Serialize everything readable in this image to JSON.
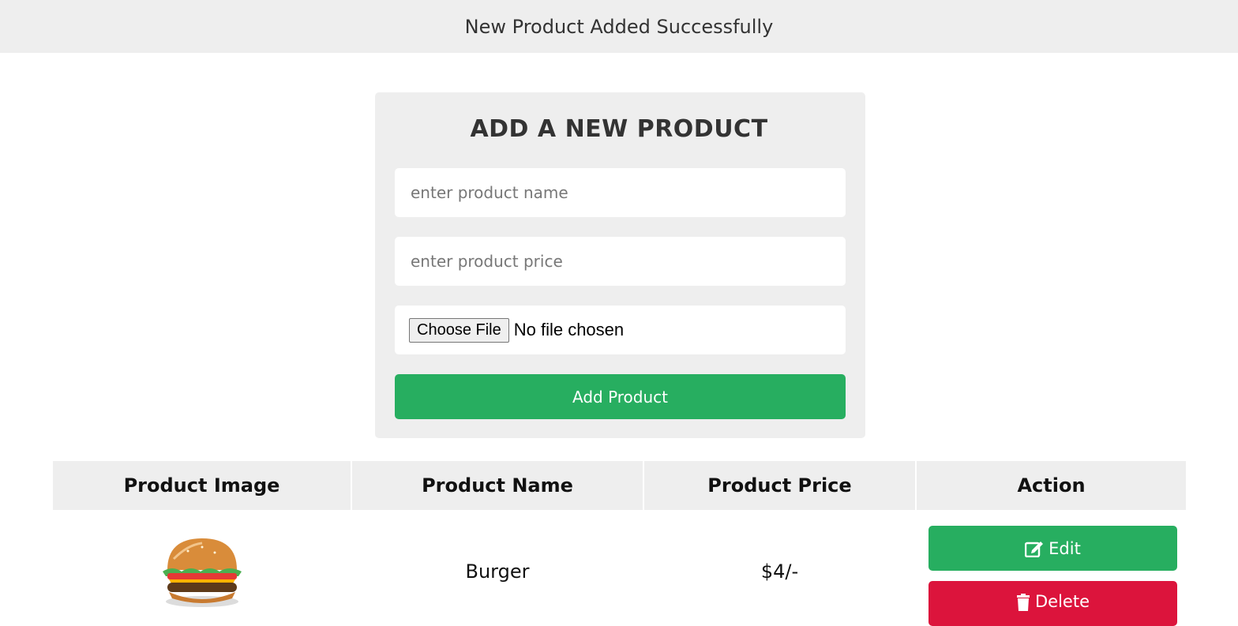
{
  "message": "New Product Added Successfully",
  "form": {
    "title": "ADD A NEW PRODUCT",
    "name_placeholder": "enter product name",
    "price_placeholder": "enter product price",
    "file_button": "Choose File",
    "file_status": "No file chosen",
    "submit_label": "Add Product"
  },
  "table": {
    "headers": [
      "Product Image",
      "Product Name",
      "Product Price",
      "Action"
    ],
    "rows": [
      {
        "image": "burger-image",
        "name": "Burger",
        "price": "$4/-",
        "edit_label": "Edit",
        "delete_label": "Delete"
      }
    ]
  },
  "colors": {
    "panel": "#eeeeee",
    "success": "#27ae60",
    "danger": "#dc143c"
  },
  "icons": {
    "edit": "edit-icon",
    "delete": "trash-icon"
  }
}
